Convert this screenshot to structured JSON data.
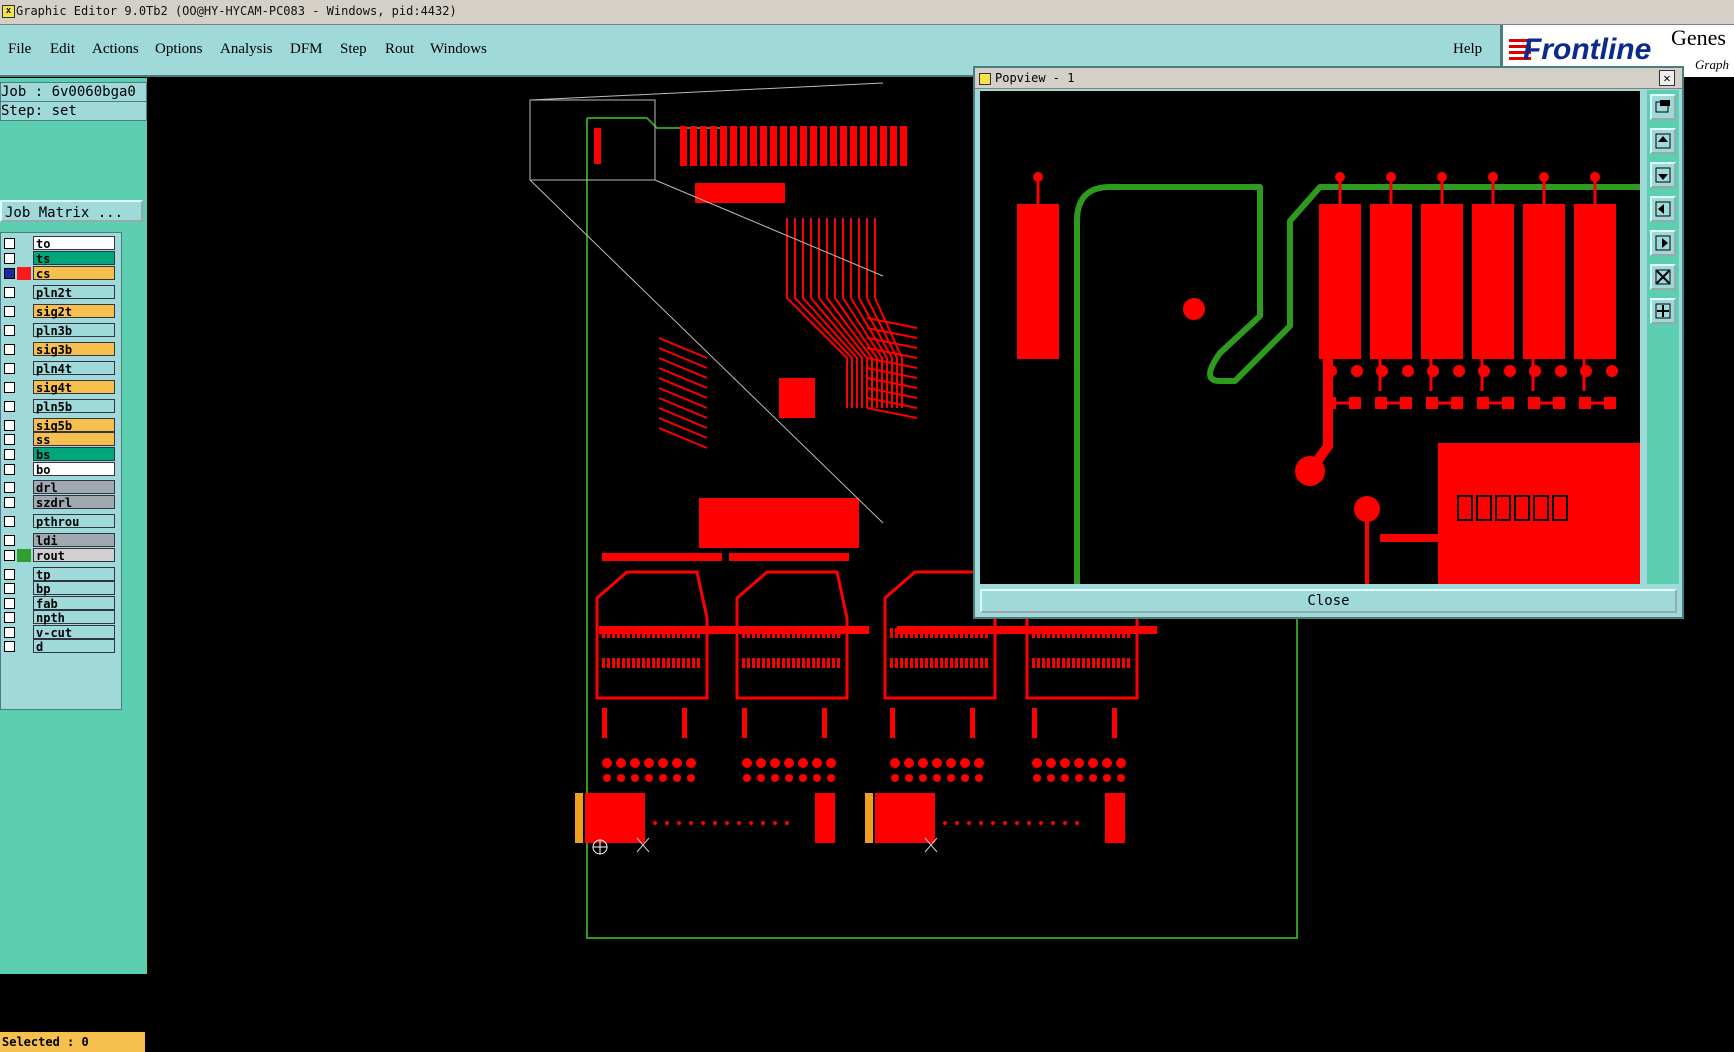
{
  "window": {
    "title": "Graphic Editor 9.0Tb2 (OO@HY-HYCAM-PC083 - Windows, pid:4432)"
  },
  "menu": {
    "items": [
      "File",
      "Edit",
      "Actions",
      "Options",
      "Analysis",
      "DFM",
      "Step",
      "Rout",
      "Windows"
    ],
    "help": "Help"
  },
  "logo": {
    "brand": "Frontline",
    "product": "Genes",
    "sub": "Graph"
  },
  "job": {
    "job_label": "Job : 6v0060bga0",
    "step_label": "Step: set",
    "matrix_button": "Job Matrix ..."
  },
  "layers": [
    {
      "name": "to",
      "color": "#ffffff",
      "swatch": ""
    },
    {
      "name": "ts",
      "color": "#00a77a",
      "swatch": ""
    },
    {
      "name": "cs",
      "color": "#f5c04e",
      "swatch": "#ff1a1a",
      "active": true
    },
    {
      "name": "pln2t",
      "color": "#9fd9d9",
      "swatch": ""
    },
    {
      "name": "sig2t",
      "color": "#f5c04e",
      "swatch": ""
    },
    {
      "name": "pln3b",
      "color": "#9fd9d9",
      "swatch": ""
    },
    {
      "name": "sig3b",
      "color": "#f5c04e",
      "swatch": ""
    },
    {
      "name": "pln4t",
      "color": "#9fd9d9",
      "swatch": ""
    },
    {
      "name": "sig4t",
      "color": "#f5c04e",
      "swatch": ""
    },
    {
      "name": "pln5b",
      "color": "#9fd9d9",
      "swatch": ""
    },
    {
      "name": "sig5b",
      "color": "#f5c04e",
      "swatch": ""
    },
    {
      "name": "ss",
      "color": "#f5c04e",
      "swatch": ""
    },
    {
      "name": "bs",
      "color": "#00a77a",
      "swatch": ""
    },
    {
      "name": "bo",
      "color": "#ffffff",
      "swatch": ""
    },
    {
      "name": "drl",
      "color": "#a0a8b0",
      "swatch": ""
    },
    {
      "name": "szdrl",
      "color": "#a0a8b0",
      "swatch": ""
    },
    {
      "name": "pthrou",
      "color": "#9fd9d9",
      "swatch": ""
    },
    {
      "name": "ldi",
      "color": "#a0a8b0",
      "swatch": ""
    },
    {
      "name": "rout",
      "color": "#d0d0d0",
      "swatch": "#2fa02f"
    },
    {
      "name": "tp",
      "color": "#9fd9d9",
      "swatch": ""
    },
    {
      "name": "bp",
      "color": "#9fd9d9",
      "swatch": ""
    },
    {
      "name": "fab",
      "color": "#9fd9d9",
      "swatch": ""
    },
    {
      "name": "npth",
      "color": "#9fd9d9",
      "swatch": ""
    },
    {
      "name": "v-cut",
      "color": "#9fd9d9",
      "swatch": ""
    },
    {
      "name": "d",
      "color": "#9fd9d9",
      "swatch": ""
    }
  ],
  "status": {
    "selected": "Selected : 0"
  },
  "popview": {
    "title": "Popview - 1",
    "close_label": "Close"
  },
  "colors": {
    "copper": "#ff0000",
    "rout": "#2f9a1f",
    "panel": "#5ccfb1",
    "menu": "#9fd9d9"
  }
}
